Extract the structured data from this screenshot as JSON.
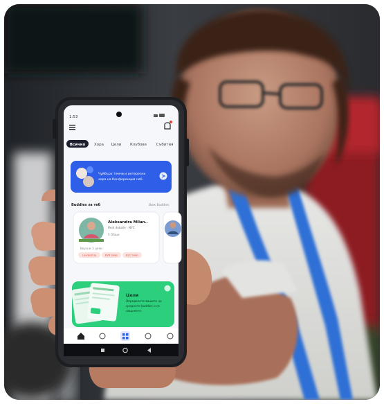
{
  "status_bar": {
    "time": "1:53"
  },
  "tabs": [
    "Всичко",
    "Хора",
    "Цели",
    "Клубове",
    "Събития"
  ],
  "banner": {
    "line1": "Чуйбърх темчи и интересни",
    "line2": "хора на Конференция неб."
  },
  "section": {
    "title": "Buddies за теб",
    "link": "Виж Buddies"
  },
  "card": {
    "name": "Aleksandra Milan..",
    "subtitle": "Real debate - NYC",
    "stat_friends": "5 Общи",
    "stat_shared": "Вкусни 3 цели",
    "tags": [
      "Leadership",
      "B2B Sales",
      "B2C Sales"
    ]
  },
  "goals_banner": {
    "title": "Цели",
    "line1": "Определете вашите на",
    "line2": "среднете buddies и се",
    "line3": "свържете."
  },
  "colors": {
    "accent_blue": "#2f5fe8",
    "accent_green": "#2ccf7c",
    "lanyard": "#2d6fd6",
    "tag_red": "#e0463c"
  },
  "icons": [
    "menu-icon",
    "bell-icon",
    "arrow-right-icon",
    "home-icon",
    "chat-icon",
    "grid-icon",
    "compass-icon",
    "profile-icon",
    "recent-apps-icon",
    "home-nav-icon",
    "back-icon"
  ]
}
